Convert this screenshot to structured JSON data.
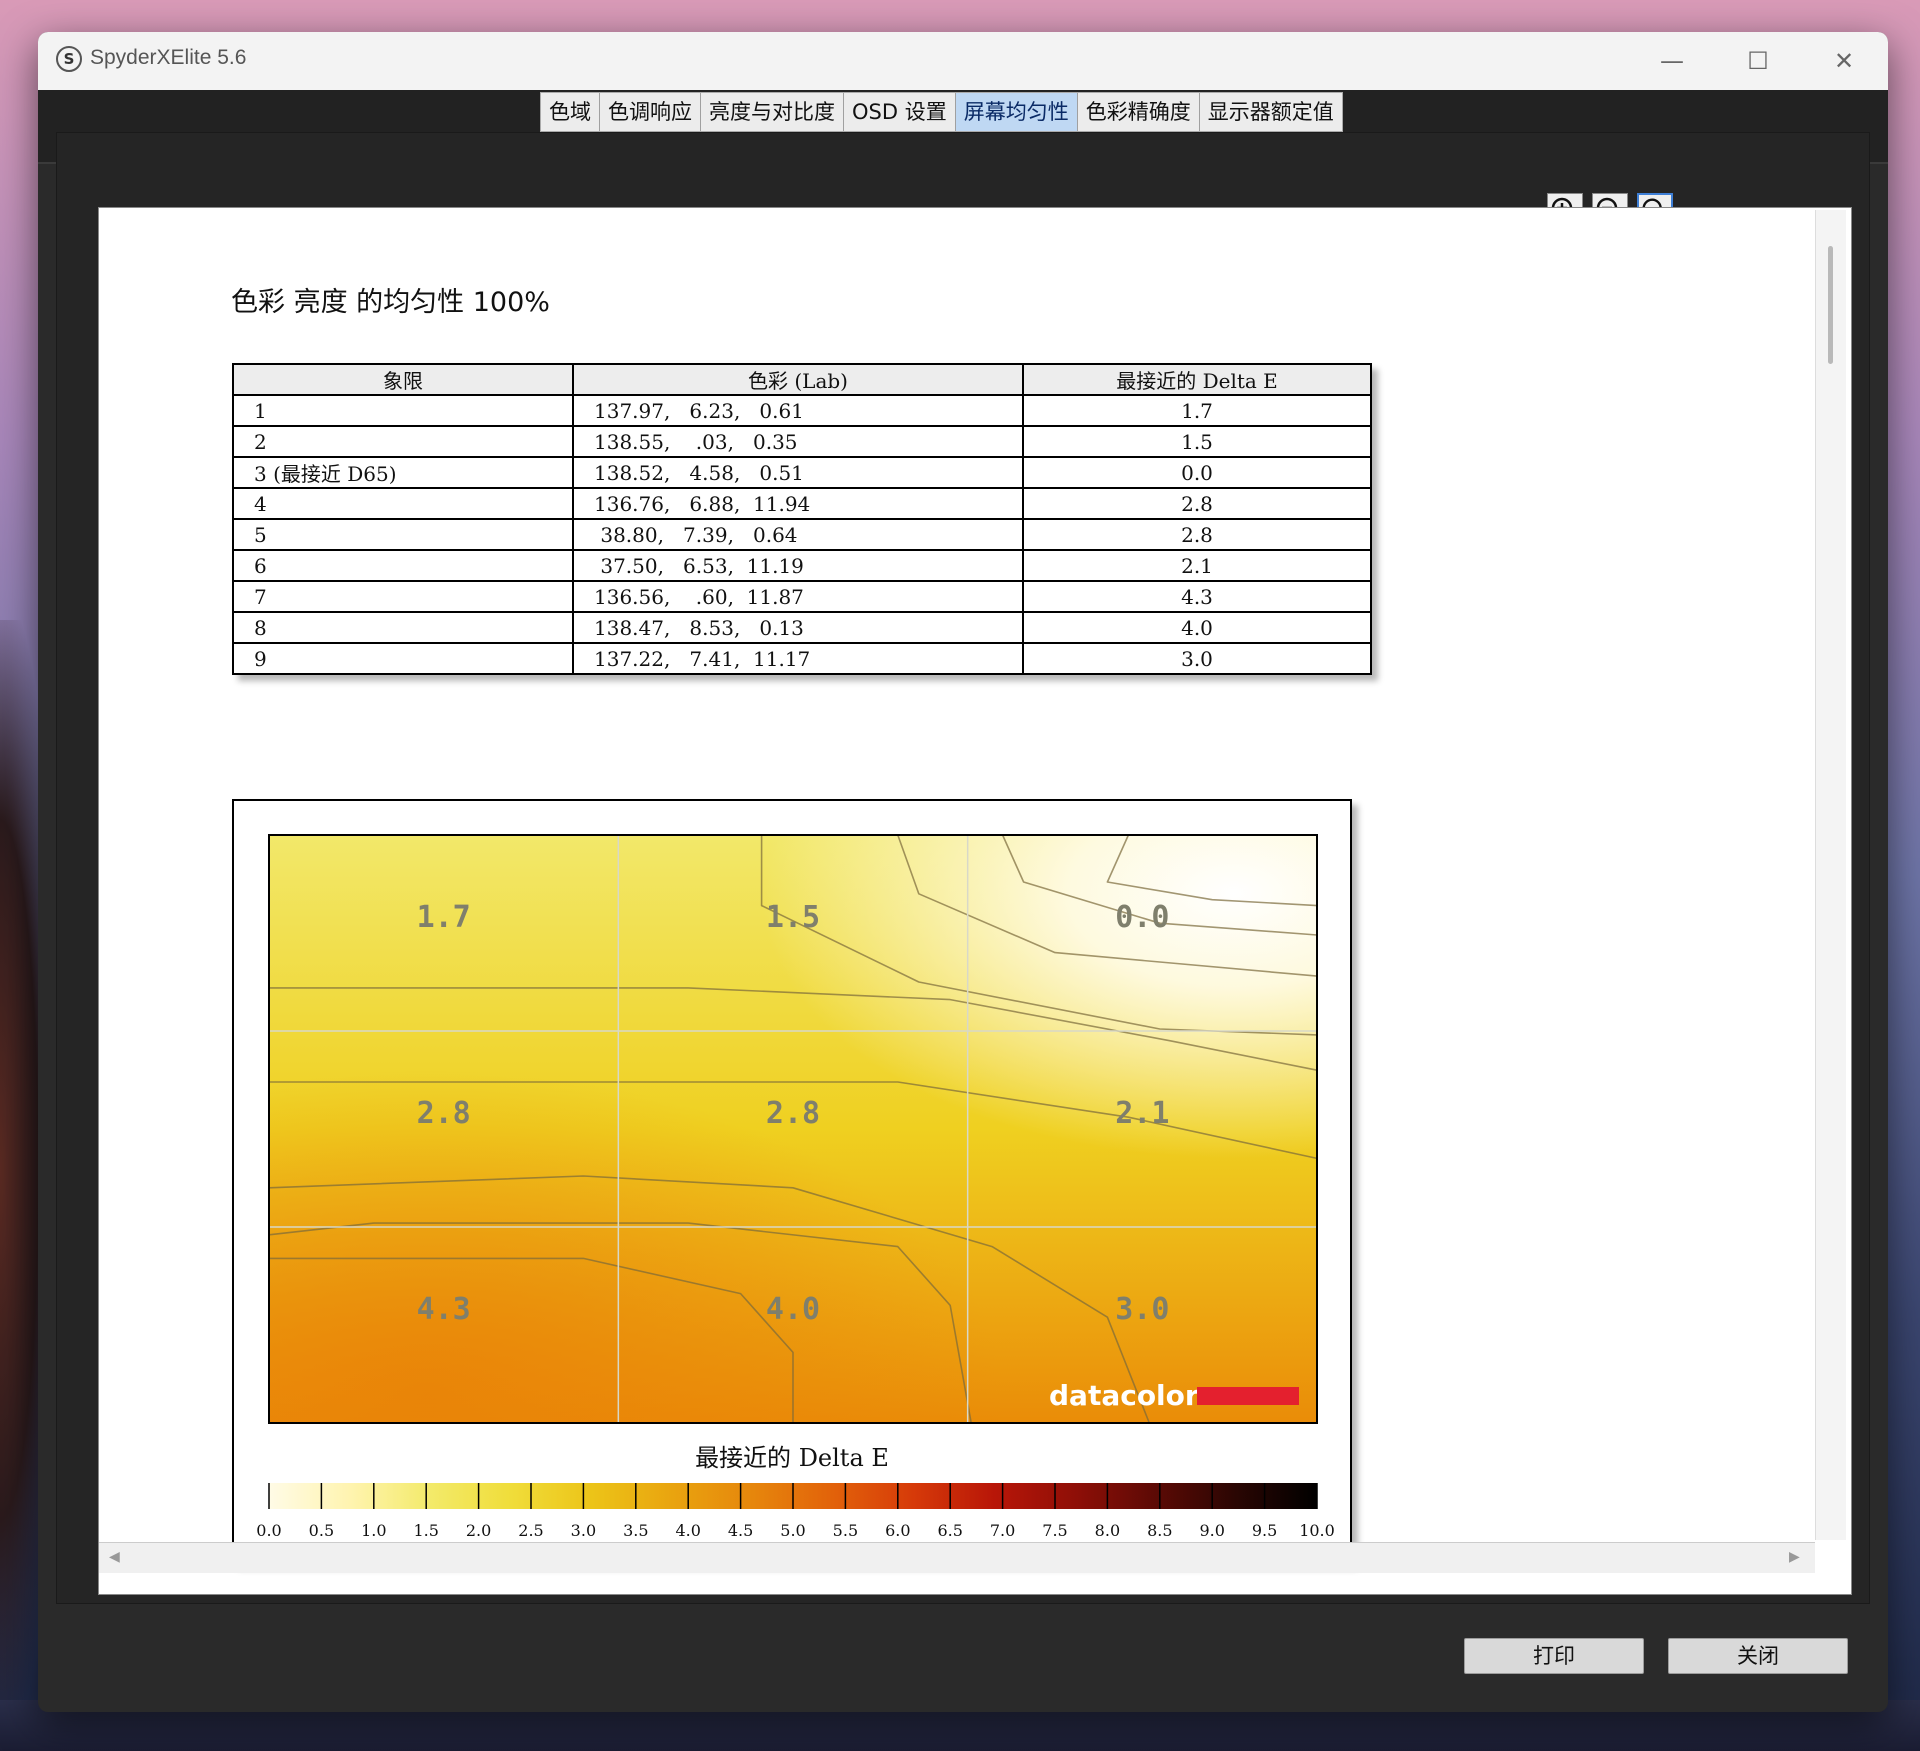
{
  "window": {
    "app_icon": "S",
    "title": "SpyderXElite 5.6",
    "controls": {
      "minimize": "—",
      "maximize": "☐",
      "close": "✕"
    }
  },
  "tabs": [
    {
      "label": "色域"
    },
    {
      "label": "色调响应"
    },
    {
      "label": "亮度与对比度"
    },
    {
      "label": "OSD 设置"
    },
    {
      "label": "屏幕均匀性",
      "active": true
    },
    {
      "label": "色彩精确度"
    },
    {
      "label": "显示器额定值"
    }
  ],
  "zoom": {
    "icons": [
      "zoom-in-icon",
      "zoom-out-icon",
      "zoom-fit-icon"
    ]
  },
  "report": {
    "title": "色彩 亮度 的均匀性 100%",
    "table": {
      "headers": [
        "象限",
        "色彩 (Lab)",
        "最接近的 Delta E"
      ],
      "rows": [
        {
          "quadrant": "1",
          "lab": "137.97,   6.23,   0.61",
          "delta_e": "1.7"
        },
        {
          "quadrant": "2",
          "lab": "138.55,    .03,   0.35",
          "delta_e": "1.5"
        },
        {
          "quadrant": "3 (最接近 D65)",
          "lab": "138.52,   4.58,   0.51",
          "delta_e": "0.0"
        },
        {
          "quadrant": "4",
          "lab": "136.76,   6.88,  11.94",
          "delta_e": "2.8"
        },
        {
          "quadrant": "5",
          "lab": " 38.80,   7.39,   0.64",
          "delta_e": "2.8"
        },
        {
          "quadrant": "6",
          "lab": " 37.50,   6.53,  11.19",
          "delta_e": "2.1"
        },
        {
          "quadrant": "7",
          "lab": "136.56,    .60,  11.87",
          "delta_e": "4.3"
        },
        {
          "quadrant": "8",
          "lab": "138.47,   8.53,   0.13",
          "delta_e": "4.0"
        },
        {
          "quadrant": "9",
          "lab": "137.22,   7.41,  11.17",
          "delta_e": "3.0"
        }
      ]
    }
  },
  "chart_data": {
    "type": "heatmap",
    "grid": {
      "rows": 3,
      "cols": 3
    },
    "cells": [
      [
        "1.7",
        "1.5",
        "0.0"
      ],
      [
        "2.8",
        "2.8",
        "2.1"
      ],
      [
        "4.3",
        "4.0",
        "3.0"
      ]
    ],
    "values": [
      [
        1.7,
        1.5,
        0.0
      ],
      [
        2.8,
        2.8,
        2.1
      ],
      [
        4.3,
        4.0,
        3.0
      ]
    ],
    "watermark": "datacolor",
    "scale": {
      "title": "最接近的 Delta E",
      "range": [
        0,
        10
      ],
      "tick_labels": [
        "0.0",
        "0.5",
        "1.0",
        "1.5",
        "2.0",
        "2.5",
        "3.0",
        "3.5",
        "4.0",
        "4.5",
        "5.0",
        "5.5",
        "6.0",
        "6.5",
        "7.0",
        "7.5",
        "8.0",
        "8.5",
        "9.0",
        "9.5",
        "10.0"
      ],
      "colors": [
        "#fffbe6",
        "#fff4b0",
        "#f3ea6a",
        "#f0dd3a",
        "#ecc418",
        "#e9a40f",
        "#e6860c",
        "#e2620a",
        "#d63a09",
        "#b81608",
        "#8f0f07",
        "#5c0a05",
        "#2a0603",
        "#000000"
      ]
    },
    "grid_lines": true
  },
  "footer": {
    "print": "打印",
    "close": "关闭"
  }
}
